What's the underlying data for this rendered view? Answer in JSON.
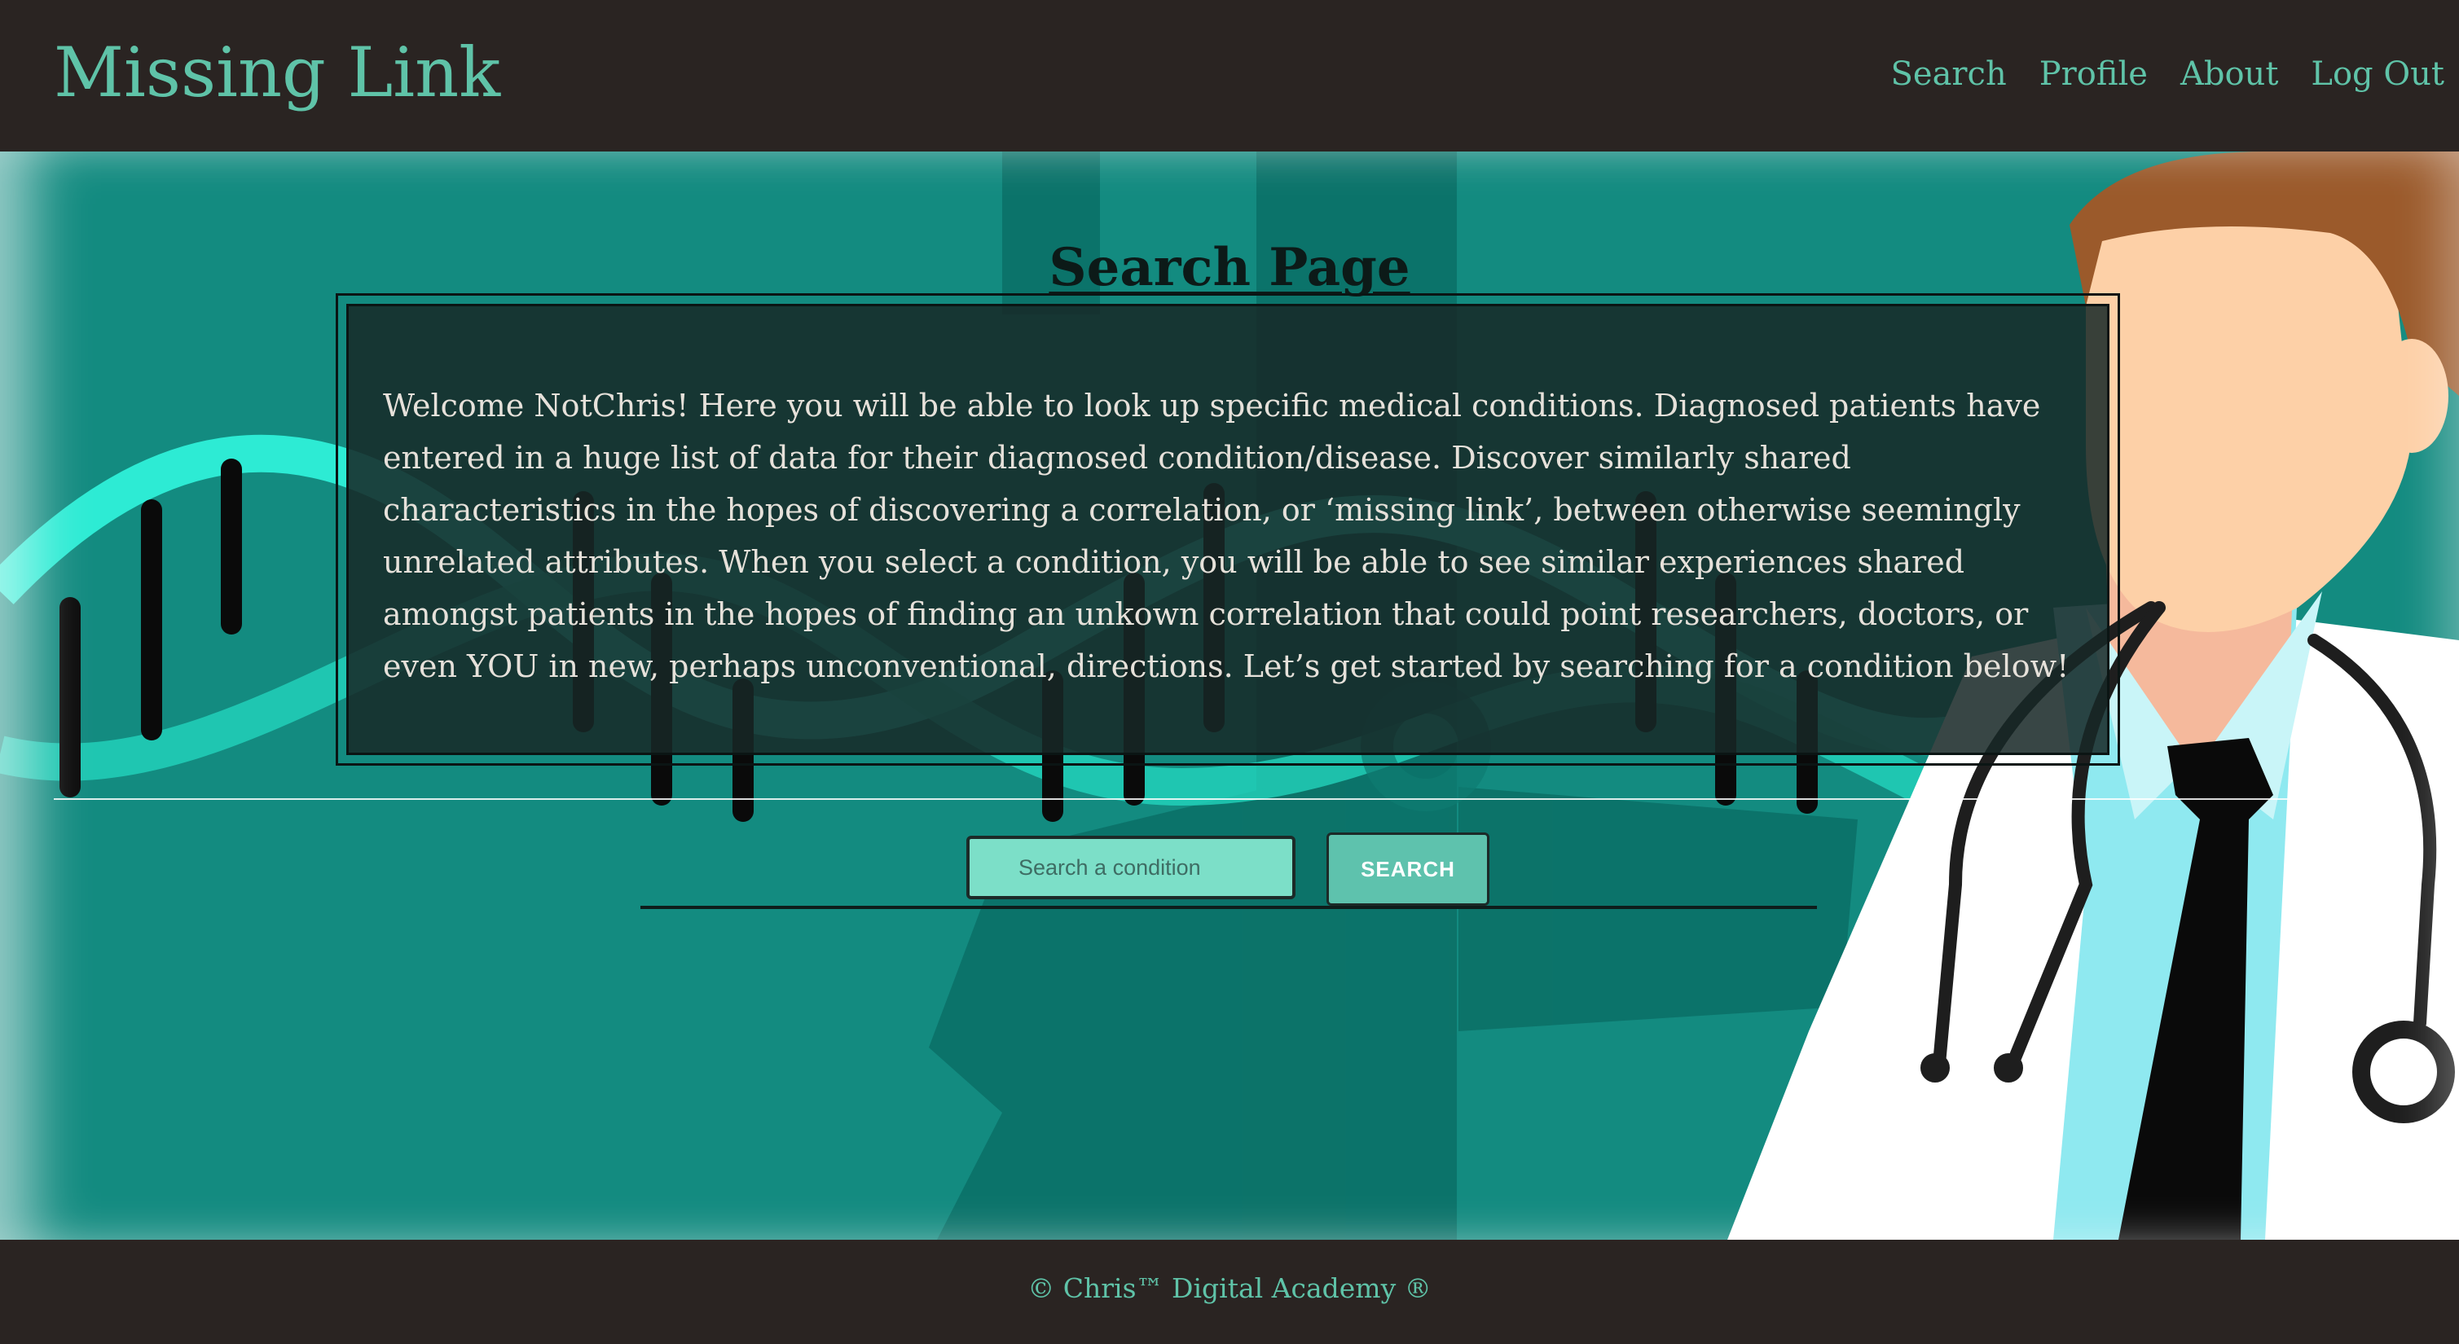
{
  "header": {
    "brand": "Missing Link",
    "nav": [
      "Search",
      "Profile",
      "About",
      "Log Out"
    ]
  },
  "main": {
    "title": "Search Page",
    "intro": "Welcome NotChris! Here you will be able to look up specific medical conditions. Diagnosed patients have entered in a huge list of data for their diagnosed condition/disease. Discover similarly shared characteristics in the hopes of discovering a correlation, or ‘missing link’, between otherwise seemingly unrelated attributes. When you select a condition, you will be able to see similar experiences shared amongst patients in the hopes of finding an unkown correlation that could point researchers, doctors, or even YOU in new, perhaps unconventional, directions. Let’s get started by searching for a condition below!",
    "search": {
      "placeholder": "Search a condition",
      "value": "",
      "button_label": "SEARCH"
    }
  },
  "footer": {
    "text": "© Chris™ Digital Academy ®"
  },
  "colors": {
    "accent": "#5fc3a8",
    "header_bg": "#2a2422",
    "hero_bg": "#138b80",
    "dna": "#2ef0d8"
  },
  "icons": [
    "dna-illustration",
    "medical-cross-illustration",
    "doctor-illustration",
    "stethoscope-icon"
  ]
}
